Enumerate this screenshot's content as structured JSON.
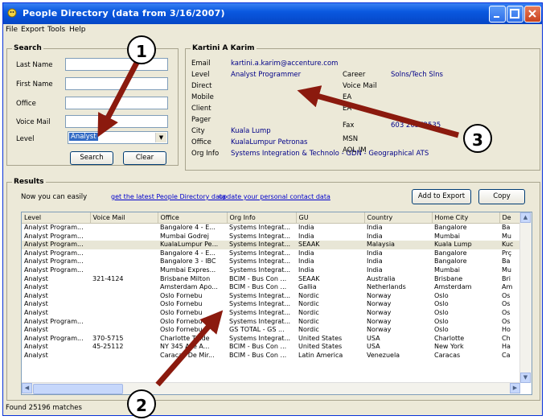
{
  "window": {
    "title": "People Directory  (data from 3/16/2007)"
  },
  "menu": [
    "File",
    "Export",
    "Tools",
    "Help"
  ],
  "search": {
    "label": "Search",
    "fields": [
      {
        "label": "Last Name",
        "value": ""
      },
      {
        "label": "First Name",
        "value": ""
      },
      {
        "label": "Office",
        "value": ""
      },
      {
        "label": "Voice Mail",
        "value": ""
      }
    ],
    "level_label": "Level",
    "level_value": "Analyst",
    "search_button": "Search",
    "clear_button": "Clear"
  },
  "details": {
    "name": "Kartini A Karim",
    "left": [
      {
        "label": "Email",
        "value": "kartini.a.karim@accenture.com"
      },
      {
        "label": "Level",
        "value": "Analyst Programmer"
      },
      {
        "label": "Direct",
        "value": ""
      },
      {
        "label": "Mobile",
        "value": ""
      },
      {
        "label": "Client",
        "value": ""
      },
      {
        "label": "Pager",
        "value": ""
      },
      {
        "label": "City",
        "value": "Kuala Lump"
      },
      {
        "label": "Office",
        "value": "KualaLumpur Petronas"
      },
      {
        "label": "Org Info",
        "value": "Systems Integration & Technolo - GDN - Geographical ATS"
      }
    ],
    "right": [
      {
        "label": "Career",
        "value": "Solns/Tech Slns"
      },
      {
        "label": "Voice Mail",
        "value": ""
      },
      {
        "label": "EA",
        "value": ""
      },
      {
        "label": "EA",
        "value": ""
      },
      {
        "label": "Fax",
        "value": "603 20572535"
      },
      {
        "label": "MSN",
        "value": ""
      },
      {
        "label": "AOL IM",
        "value": ""
      }
    ]
  },
  "results": {
    "label": "Results",
    "intro": "Now you can easily",
    "link1": "get the latest People Directory data",
    "link2": "update your personal contact data",
    "add_button": "Add to Export",
    "copy_button": "Copy",
    "columns": [
      "Level",
      "Voice Mail",
      "Office",
      "Org Info",
      "GU",
      "Country",
      "Home City",
      "De"
    ],
    "rows": [
      [
        "Analyst Program...",
        "",
        "Bangalore 4 - E...",
        "Systems Integrat...",
        "India",
        "India",
        "Bangalore",
        "Ba"
      ],
      [
        "Analyst Program...",
        "",
        "Mumbai Godrej",
        "Systems Integrat...",
        "India",
        "India",
        "Mumbai",
        "Mu"
      ],
      [
        "Analyst Program...",
        "",
        "KualaLumpur Pe...",
        "Systems Integrat...",
        "SEAAK",
        "Malaysia",
        "Kuala Lump",
        "Kuc"
      ],
      [
        "Analyst Program...",
        "",
        "Bangalore 4 - E...",
        "Systems Integrat...",
        "India",
        "India",
        "Bangalore",
        "Prç"
      ],
      [
        "Analyst Program...",
        "",
        "Bangalore 3 - IBC",
        "Systems Integrat...",
        "India",
        "India",
        "Bangalore",
        "Ba"
      ],
      [
        "Analyst Program...",
        "",
        "Mumbai Expres...",
        "Systems Integrat...",
        "India",
        "India",
        "Mumbai",
        "Mu"
      ],
      [
        "Analyst",
        "321-4124",
        "Brisbane Milton",
        "BCIM - Bus Con ...",
        "SEAAK",
        "Australia",
        "Brisbane",
        "Bri"
      ],
      [
        "Analyst",
        "",
        "Amsterdam Apo...",
        "BCIM - Bus Con ...",
        "Gallia",
        "Netherlands",
        "Amsterdam",
        "Am"
      ],
      [
        "Analyst",
        "",
        "Oslo Fornebu",
        "Systems Integrat...",
        "Nordic",
        "Norway",
        "Oslo",
        "Os"
      ],
      [
        "Analyst",
        "",
        "Oslo Fornebu",
        "Systems Integrat...",
        "Nordic",
        "Norway",
        "Oslo",
        "Os"
      ],
      [
        "Analyst",
        "",
        "Oslo Fornebu",
        "Systems Integrat...",
        "Nordic",
        "Norway",
        "Oslo",
        "Os"
      ],
      [
        "Analyst Program...",
        "",
        "Oslo Fornebu",
        "Systems Integrat...",
        "Nordic",
        "Norway",
        "Oslo",
        "Os"
      ],
      [
        "Analyst",
        "",
        "Oslo Fornebu",
        "GS TOTAL - GS ...",
        "Nordic",
        "Norway",
        "Oslo",
        "Ho"
      ],
      [
        "Analyst Program...",
        "370-5715",
        "Charlotte Trade",
        "Systems Integrat...",
        "United States",
        "USA",
        "Charlotte",
        "Ch"
      ],
      [
        "Analyst",
        "45-25112",
        "NY 345 Ave A...",
        "BCIM - Bus Con ...",
        "United States",
        "USA",
        "New York",
        "Ha"
      ],
      [
        "Analyst",
        "",
        "Caracas De Mir...",
        "BCIM - Bus Con ...",
        "Latin America",
        "Venezuela",
        "Caracas",
        "Ca"
      ]
    ]
  },
  "status": "Found 25196 matches",
  "callouts": [
    "1",
    "2",
    "3"
  ],
  "colors": {
    "titlebar": "#0a58e0",
    "arrow": "#8b1a0e",
    "link": "#0000cc",
    "value_text": "#000088"
  }
}
